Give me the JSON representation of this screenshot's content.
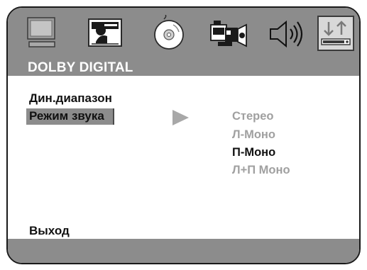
{
  "toolbar": {
    "icons": [
      {
        "name": "monitor-icon",
        "active": false
      },
      {
        "name": "picture-icon",
        "active": false
      },
      {
        "name": "disc-icon",
        "active": false
      },
      {
        "name": "camera-icon",
        "active": false
      },
      {
        "name": "speaker-icon",
        "active": false
      },
      {
        "name": "audio-settings-icon",
        "active": true
      }
    ]
  },
  "title": "DOLBY DIGITAL",
  "menu": {
    "items": [
      {
        "label": "Дин.диапазон",
        "selected": false
      },
      {
        "label": "Режим звука",
        "selected": true
      }
    ],
    "exit_label": "Выход"
  },
  "submenu": {
    "options": [
      {
        "label": "Стерео",
        "active": false
      },
      {
        "label": "Л-Моно",
        "active": false
      },
      {
        "label": "П-Моно",
        "active": true
      },
      {
        "label": "Л+П Моно",
        "active": false
      }
    ]
  },
  "colors": {
    "bar": "#8c8c8c",
    "text": "#111111",
    "inactive_text": "#a0a0a0",
    "title_text": "#ffffff"
  }
}
